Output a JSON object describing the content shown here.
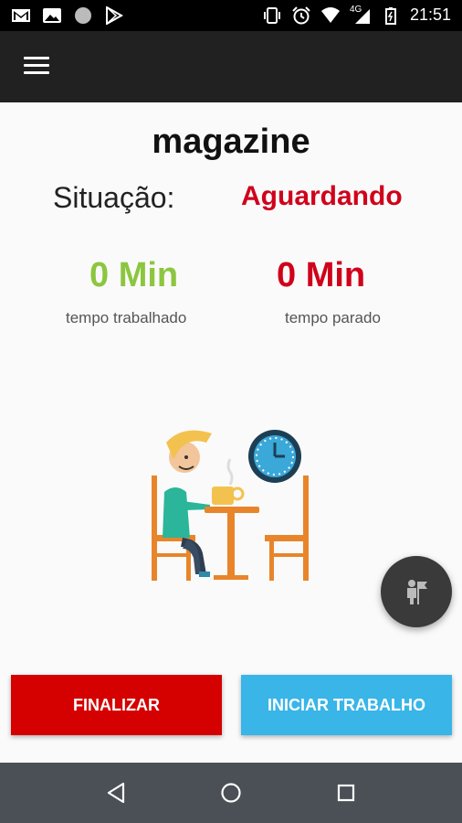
{
  "status_bar": {
    "left_icons": [
      "gmail-icon",
      "photo-icon",
      "circle-icon",
      "play-store-icon"
    ],
    "right_icons": [
      "vibrate-icon",
      "alarm-icon",
      "wifi-icon",
      "signal-icon",
      "battery-icon"
    ],
    "network": "4G",
    "time": "21:51"
  },
  "app_bar": {
    "menu_icon": "menu-icon"
  },
  "main": {
    "title": "magazine",
    "situation_label": "Situação:",
    "situation_value": "Aguardando",
    "worked_time": "0 Min",
    "worked_label": "tempo trabalhado",
    "stopped_time": "0 Min",
    "stopped_label": "tempo parado"
  },
  "buttons": {
    "finish_label": "FINALIZAR",
    "start_label": "INICIAR TRABALHO"
  },
  "colors": {
    "finish": "#d50000",
    "start": "#39b5e8",
    "worked": "#8cc63f",
    "stopped": "#d0021b",
    "situation": "#d0021b"
  },
  "nav_bar": {
    "icons": [
      "back-icon",
      "home-icon",
      "recents-icon"
    ]
  }
}
